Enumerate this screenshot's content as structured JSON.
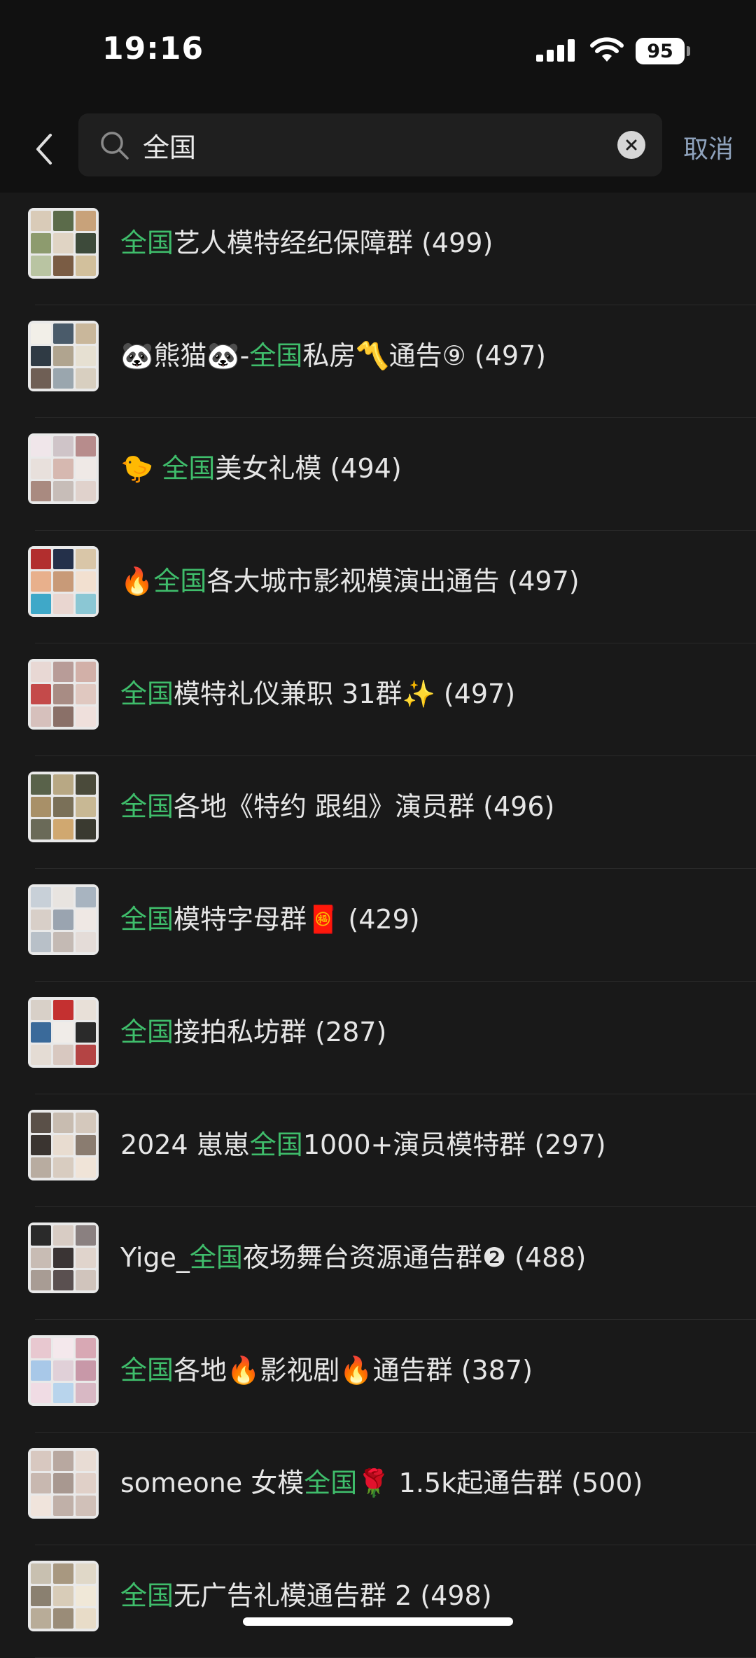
{
  "status": {
    "time": "19:16",
    "battery": "95"
  },
  "search": {
    "query": "全国",
    "cancel_label": "取消"
  },
  "results": [
    {
      "pre": "",
      "match": "全国",
      "post": "艺人模特经纪保障群 (499)"
    },
    {
      "pre": "🐼熊猫🐼-",
      "match": "全国",
      "post": "私房〽️通告⑨ (497)"
    },
    {
      "pre": "🐤 ",
      "match": "全国",
      "post": "美女礼模 (494)"
    },
    {
      "pre": "🔥",
      "match": "全国",
      "post": "各大城市影视模演出通告 (497)"
    },
    {
      "pre": "",
      "match": "全国",
      "post": "模特礼仪兼职 31群✨ (497)"
    },
    {
      "pre": "",
      "match": "全国",
      "post": "各地《特约 跟组》演员群 (496)"
    },
    {
      "pre": "",
      "match": "全国",
      "post": "模特字母群🧧 (429)"
    },
    {
      "pre": "",
      "match": "全国",
      "post": "接拍私坊群 (287)"
    },
    {
      "pre": "2024 崽崽",
      "match": "全国",
      "post": "1000+演员模特群 (297)"
    },
    {
      "pre": "Yige_",
      "match": "全国",
      "post": "夜场舞台资源通告群❷ (488)"
    },
    {
      "pre": "",
      "match": "全国",
      "post": "各地🔥影视剧🔥通告群 (387)"
    },
    {
      "pre": "someone 女模",
      "match": "全国",
      "post": "🌹 1.5k起通告群 (500)"
    },
    {
      "pre": "",
      "match": "全国",
      "post": "无广告礼模通告群 2 (498)"
    }
  ],
  "colors": {
    "highlight": "#3fbd6b",
    "background": "#191919",
    "cancel": "#8fa3bd"
  }
}
